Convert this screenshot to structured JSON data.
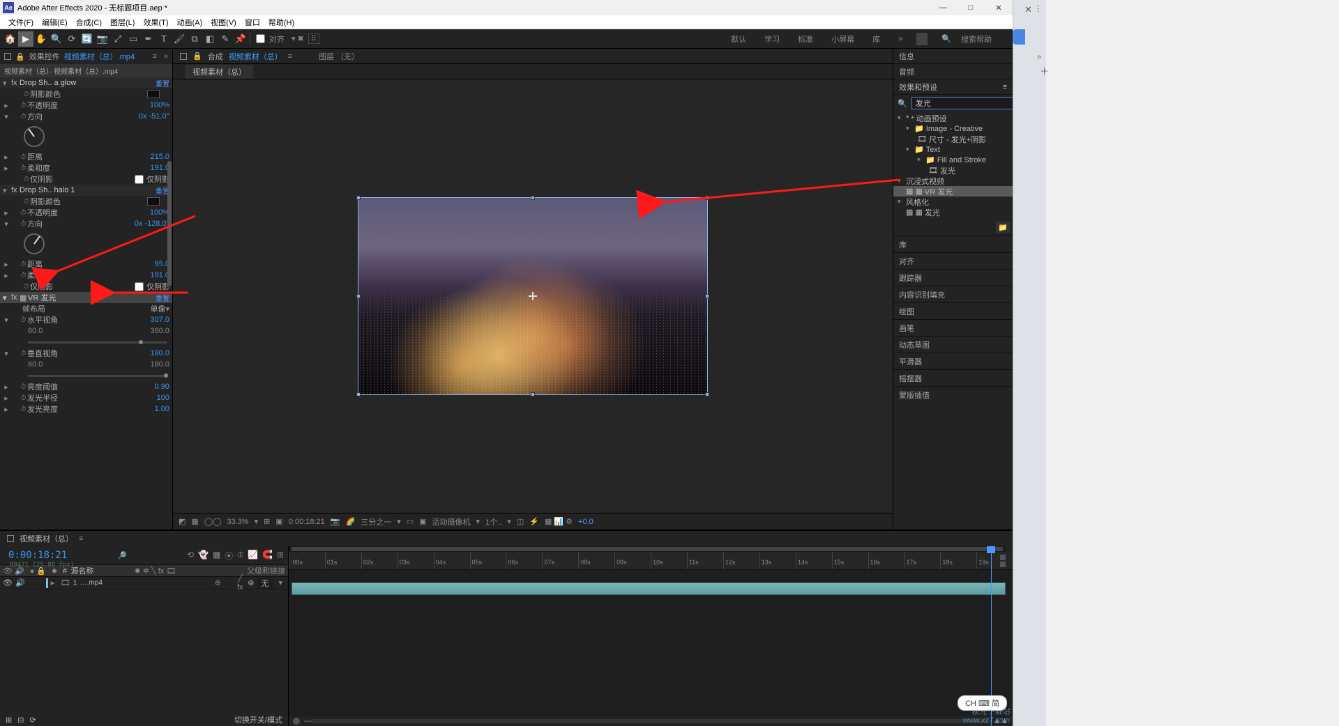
{
  "title": "Adobe After Effects 2020 - 无标题项目.aep *",
  "menu": [
    "文件(F)",
    "编辑(E)",
    "合成(C)",
    "图层(L)",
    "效果(T)",
    "动画(A)",
    "视图(V)",
    "窗口",
    "帮助(H)"
  ],
  "toolbar": {
    "snapping_label": "对齐"
  },
  "workspaces": [
    "默认",
    "学习",
    "标准",
    "小屏幕",
    "库"
  ],
  "search_placeholder": "搜索帮助",
  "left_panel": {
    "tab_prefix": "效果控件",
    "tab_blue": "视频素材（总）.mp4",
    "header_line": "视频素材（总）· 视频素材（总）.mp4",
    "reset_label": "重置",
    "fx_top_name": "Drop Sh.. a glow",
    "fx2_name": "Drop Sh..  halo 1",
    "fx3_name": "VR 发光",
    "prop": {
      "shadow_color": "阴影颜色",
      "opacity": "不透明度",
      "direction": "方向",
      "distance": "距离",
      "softness": "柔和度",
      "shadow_only": "仅阴影",
      "shadow_only_val": "仅阴影",
      "frame_layout": "帧布局",
      "h_fov": "水平视角",
      "v_fov": "垂直视角",
      "lum_threshold": "亮度阈值",
      "glow_radius": "发光半径",
      "glow_brightness": "发光亮度"
    },
    "val": {
      "opacity1": "100%",
      "dir1": "0x -51.0°",
      "distance1": "215.0",
      "soft1": "191.0",
      "opacity2": "100%",
      "dir2": "0x -128.0°",
      "distance2": "95.0",
      "soft2": "191.0",
      "frame_layout": "单像",
      "hfov": "307.0",
      "hv_min": "60.0",
      "hv_max": "360.0",
      "vfov": "180.0",
      "vv_min": "60.0",
      "vv_max": "180.0",
      "lum": "0.90",
      "radius": "100",
      "bright": "1.00"
    }
  },
  "center": {
    "tab_prefix": "合成",
    "tab_blue": "视频素材（总）",
    "layout_label": "图层 （无）",
    "flowchart": "视频素材（总）"
  },
  "viewerbar": {
    "zoom": "33.3%",
    "time": "0:00:18:21",
    "res": "三分之一",
    "camera": "活动摄像机",
    "views": "1个..",
    "exposure": "+0.0"
  },
  "right": {
    "info": "信息",
    "audio": "音频",
    "effects_presets": "效果和预设",
    "search_value": "发光",
    "tree": {
      "anim_presets": "* 动画预设",
      "ic_folder": "Image - Creative",
      "ic_item": "尺寸 - 发光+阴影",
      "text_folder": "Text",
      "fs_folder": "Fill and Stroke",
      "fs_item": "发光",
      "immersive": "沉浸式视频",
      "vr_glow": "VR 发光",
      "stylize": "风格化",
      "glow": "发光"
    },
    "lower": [
      "库",
      "对齐",
      "跟踪器",
      "内容识别填充",
      "绘图",
      "画笔",
      "动态草图",
      "平滑器",
      "摇摆器",
      "蒙版插值"
    ]
  },
  "timeline": {
    "tab": "视频素材（总）",
    "timecode": "0:00:18:21",
    "frames": "00471 (25.00 fps)",
    "col_num": "#",
    "col_source": "源名称",
    "col_parent": "父级和链接",
    "layer_num": "1",
    "layer_name": "….mp4",
    "parent_none": "无",
    "ruler": [
      ":00s",
      "01s",
      "02s",
      "03s",
      "04s",
      "05s",
      "06s",
      "07s",
      "08s",
      "09s",
      "10s",
      "11s",
      "12s",
      "13s",
      "14s",
      "15s",
      "16s",
      "17s",
      "18s",
      "19s"
    ],
    "footer": "切换开关/模式"
  },
  "ime": "CH ⌨ 简"
}
